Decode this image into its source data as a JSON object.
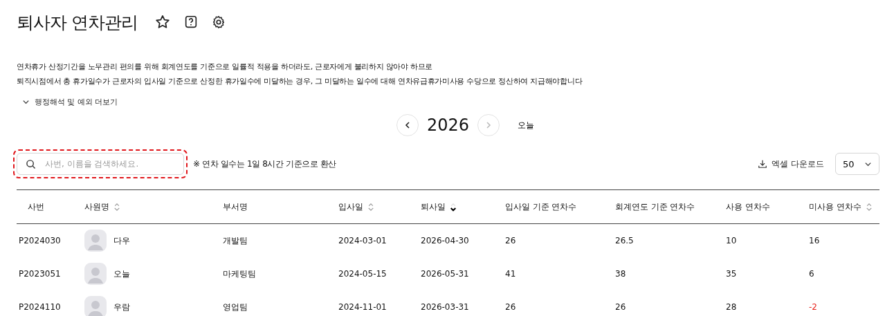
{
  "page": {
    "title": "퇴사자 연차관리"
  },
  "notice": [
    "연차휴가 산정기간을 노무관리 편의를 위해 회계연도를 기준으로 일률적 적용을 하더라도, 근로자에게 불리하지 않아야 하므로",
    "퇴직시점에서 총 휴가일수가 근로자의 입사일 기준으로 산정한 휴가일수에 미달하는 경우, 그 미달하는 일수에 대해 연차유급휴가미사용 수당으로 정산하여 지급해야합니다"
  ],
  "more_toggle": {
    "label": "행정해석 및 예외 더보기",
    "expanded": false
  },
  "year_nav": {
    "year": "2026",
    "prev_disabled": false,
    "next_disabled": true,
    "today": "오늘"
  },
  "search": {
    "placeholder": "사번, 이름을 검색하세요.",
    "highlighted": true
  },
  "note": "※ 연차 일수는 1일 8시간 기준으로 환산",
  "download": {
    "label": "엑셀 다운로드"
  },
  "page_size": {
    "value": "50"
  },
  "table": {
    "columns": [
      {
        "label": "사번",
        "sortable": false
      },
      {
        "label": "사원명",
        "sortable": true,
        "sorted": false
      },
      {
        "label": "부서명",
        "sortable": false
      },
      {
        "label": "입사일",
        "sortable": true,
        "sorted": false
      },
      {
        "label": "퇴사일",
        "sortable": true,
        "sorted": true
      },
      {
        "label": "입사일 기준 연차수",
        "sortable": false
      },
      {
        "label": "회계연도 기준 연차수",
        "sortable": false
      },
      {
        "label": "사용 연차수",
        "sortable": false
      },
      {
        "label": "미사용 연차수",
        "sortable": true,
        "sorted": false
      }
    ],
    "rows": [
      {
        "id": "P2024030",
        "name": "다우",
        "dept": "개발팀",
        "hired": "2024-03-01",
        "left": "2026-04-30",
        "by_hire": "26",
        "by_fiscal": "26.5",
        "used": "10",
        "unused": "16",
        "unused_negative": false
      },
      {
        "id": "P2023051",
        "name": "오늘",
        "dept": "마케팅팀",
        "hired": "2024-05-15",
        "left": "2026-05-31",
        "by_hire": "41",
        "by_fiscal": "38",
        "used": "35",
        "unused": "6",
        "unused_negative": false
      },
      {
        "id": "P2024110",
        "name": "우람",
        "dept": "영업팀",
        "hired": "2024-11-01",
        "left": "2026-03-31",
        "by_hire": "26",
        "by_fiscal": "26",
        "used": "28",
        "unused": "-2",
        "unused_negative": true
      }
    ]
  }
}
